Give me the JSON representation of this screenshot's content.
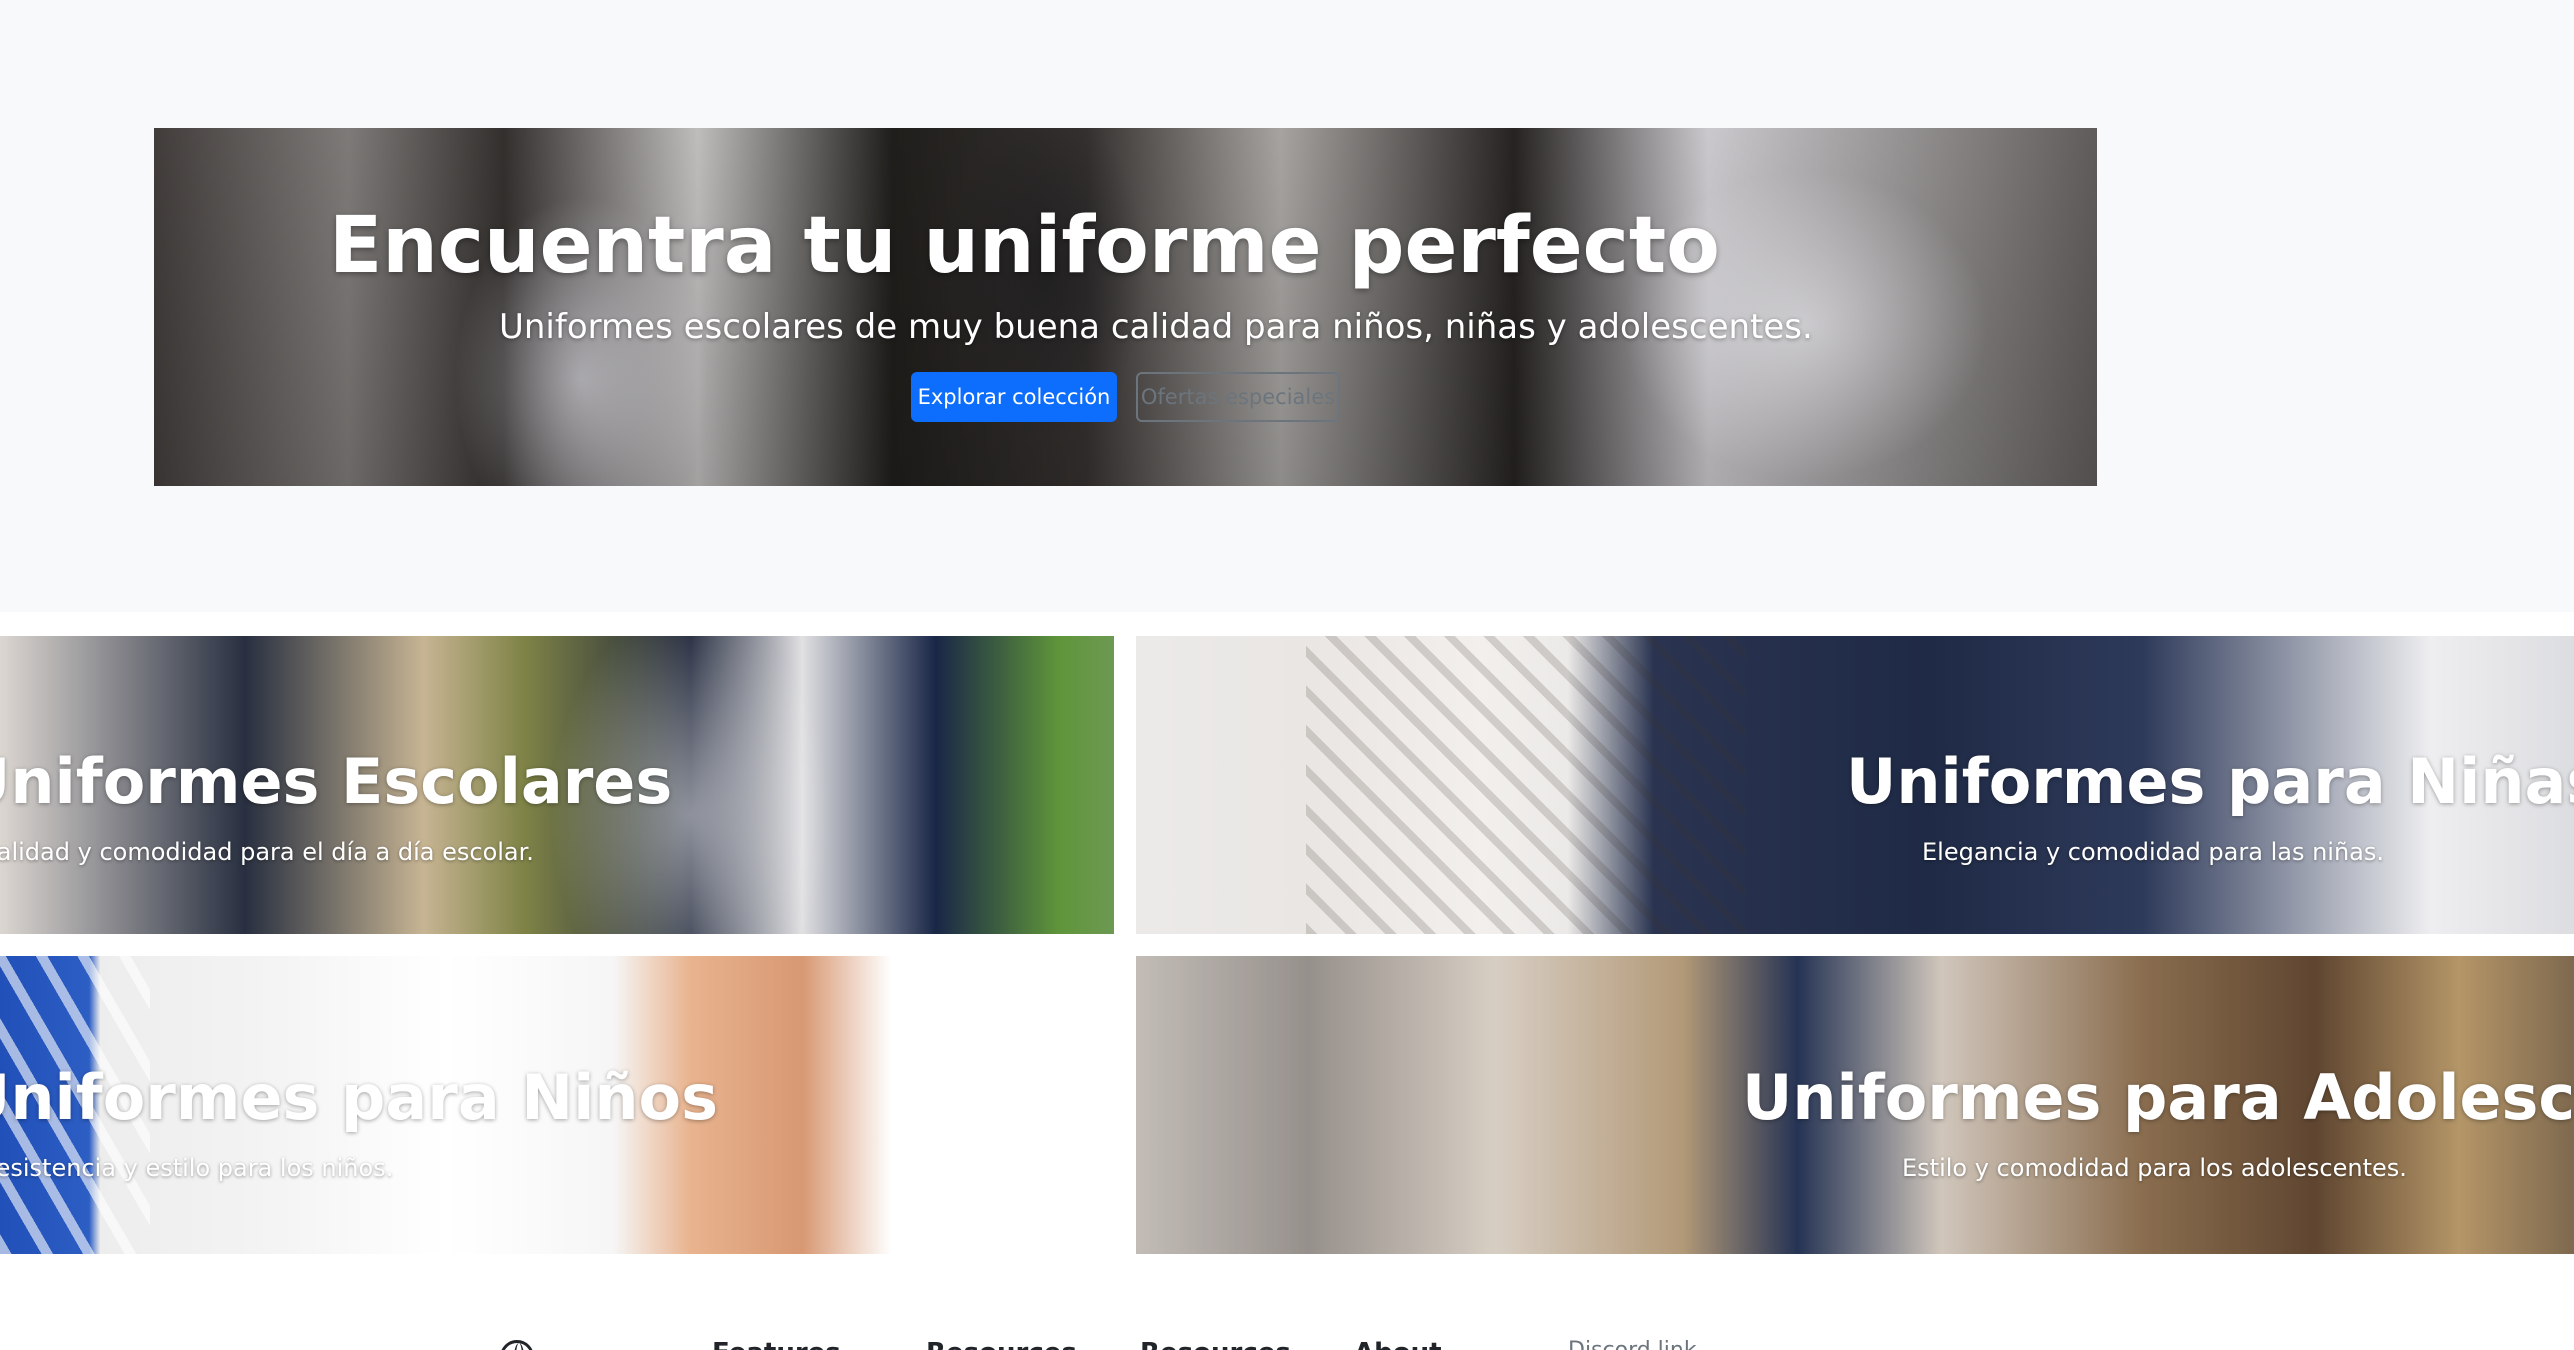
{
  "hero": {
    "title": "Encuentra tu uniforme perfecto",
    "subtitle": "Uniformes escolares de muy buena calidad para niños, niñas y adolescentes.",
    "primary_button": "Explorar colección",
    "secondary_button": "Ofertas especiales"
  },
  "categories": [
    {
      "title": "Uniformes Escolares",
      "description": "Calidad y comodidad para el día a día escolar."
    },
    {
      "title": "Uniformes para Niñas",
      "description": "Elegancia y comodidad para las niñas."
    },
    {
      "title": "Uniformes para Niños",
      "description": "Resistencia y estilo para los niños."
    },
    {
      "title": "Uniformes para Adolescentes",
      "description": "Estilo y comodidad para los adolescentes."
    }
  ],
  "footer": {
    "logo_icon": "globe-icon",
    "links": [
      "Features",
      "Resources",
      "Resources",
      "About",
      "Discord link"
    ]
  },
  "colors": {
    "primary": "#0d6efd",
    "secondary": "#6c757d",
    "hero_background": "#f8f9fa"
  }
}
